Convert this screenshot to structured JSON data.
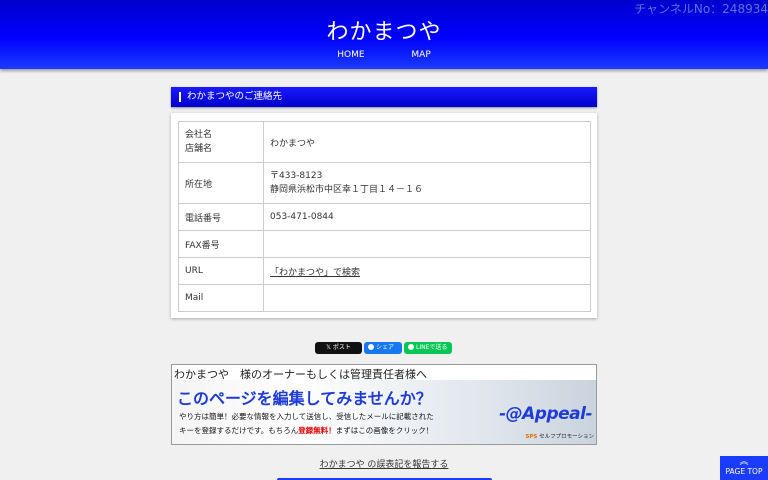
{
  "header": {
    "channel_no": "チャンネルNo：248934",
    "site_title": "わかまつや",
    "nav": [
      "HOME",
      "MAP"
    ]
  },
  "section": {
    "title": "わかまつやのご連絡先"
  },
  "contact": {
    "company_label_1": "会社名",
    "company_label_2": "店舗名",
    "company_value": "わかまつや",
    "address_label": "所在地",
    "postal": "〒433-8123",
    "address": "静岡県浜松市中区幸１丁目１４－１６",
    "phone_label": "電話番号",
    "phone": "053-471-0844",
    "fax_label": "FAX番号",
    "fax": "",
    "url_label": "URL",
    "url_link": "「わかまつや」で検索",
    "mail_label": "Mail",
    "mail": ""
  },
  "share": {
    "x_label": "𝕏 ポスト",
    "fb_label": "シェア",
    "line_label": "LINEで送る"
  },
  "banner": {
    "owner_text": "わかまつや　様のオーナーもしくは管理責任者様へ",
    "headline": "このページを編集してみませんか？",
    "desc_line1": "やり方は簡単！必要な情報を入力して送信し、受信したメールに記載された",
    "desc_line2_a": "キーを登録するだけです。もちろん",
    "desc_line2_red": "登録無料！",
    "desc_line2_b": "まずはこの画像をクリック！",
    "logo": "-@Appeal-",
    "sps_mark": "SPS",
    "sps_text": "セルフプロモーション"
  },
  "footer": {
    "report_link": "わかまつや の誤表記を報告する",
    "page_top": "PAGE TOP"
  },
  "colors": {
    "brand_blue": "#0000ff",
    "accent_red": "#e00000"
  }
}
